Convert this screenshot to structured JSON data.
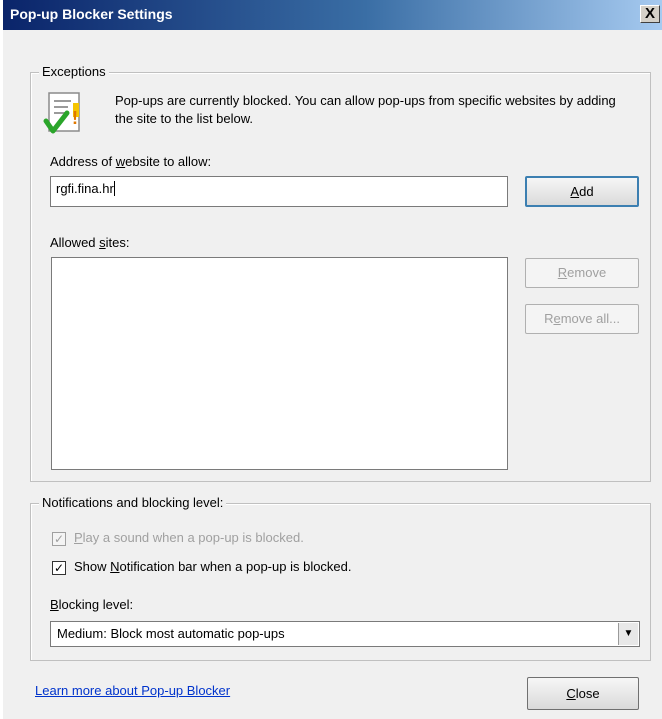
{
  "window": {
    "title": "Pop-up Blocker Settings",
    "close_glyph": "X"
  },
  "exceptions": {
    "legend": "Exceptions",
    "info_icon": "document-warning-check-icon",
    "info_text": "Pop-ups are currently blocked.  You can allow pop-ups from specific websites by adding the site to the list below.",
    "address_label_pre": "Address of ",
    "address_label_key": "w",
    "address_label_post": "ebsite to allow:",
    "address_value": "rgfi.fina.hr",
    "add_button_key": "A",
    "add_button_rest": "dd",
    "allowed_label_pre": "Allowed ",
    "allowed_label_key": "s",
    "allowed_label_post": "ites:",
    "allowed_sites": [],
    "remove_button_key": "R",
    "remove_button_rest": "emove",
    "remove_all_pre": "R",
    "remove_all_key": "e",
    "remove_all_post": "move all..."
  },
  "notifications": {
    "legend": "Notifications and blocking level:",
    "play_sound_key": "P",
    "play_sound_rest": "lay a sound when a pop-up is blocked.",
    "play_sound_checked": true,
    "play_sound_enabled": false,
    "show_bar_pre": "Show ",
    "show_bar_key": "N",
    "show_bar_post": "otification bar when a pop-up is blocked.",
    "show_bar_checked": true,
    "blocking_level_key": "B",
    "blocking_level_rest": "locking level:",
    "blocking_level_value": "Medium: Block most automatic pop-ups"
  },
  "footer": {
    "learn_more_link": "Learn more about Pop-up Blocker",
    "close_button_key": "C",
    "close_button_rest": "lose"
  },
  "colors": {
    "title_bar_start": "#0a246a",
    "title_bar_end": "#a6caf0",
    "dialog_background": "#f0f0f0",
    "link": "#0033cc",
    "disabled_text": "#a0a0a0"
  }
}
